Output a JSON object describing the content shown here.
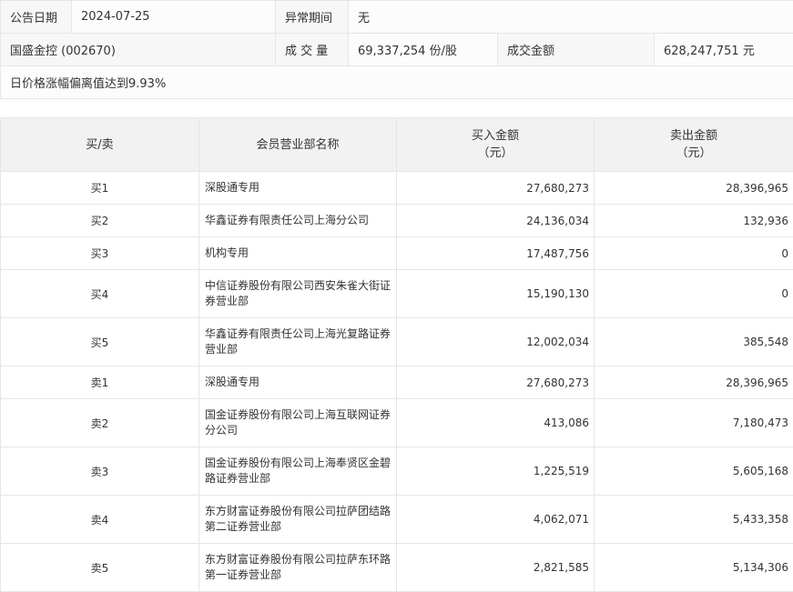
{
  "info": {
    "date_label": "公告日期",
    "date_value": "2024-07-25",
    "period_label": "异常期间",
    "period_value": "无",
    "stock": "国盛金控 (002670)",
    "volume_label": "成 交 量",
    "volume_value": "69,337,254 份/股",
    "amount_label": "成交金额",
    "amount_value": "628,247,751 元",
    "reason": "日价格涨幅偏离值达到9.93%"
  },
  "table": {
    "headers": {
      "side": "买/卖",
      "name": "会员营业部名称",
      "buy_l1": "买入金额",
      "buy_l2": "（元）",
      "sell_l1": "卖出金额",
      "sell_l2": "（元）"
    },
    "rows": [
      {
        "side": "买1",
        "name": "深股通专用",
        "buy": "27,680,273",
        "sell": "28,396,965"
      },
      {
        "side": "买2",
        "name": "华鑫证券有限责任公司上海分公司",
        "buy": "24,136,034",
        "sell": "132,936"
      },
      {
        "side": "买3",
        "name": "机构专用",
        "buy": "17,487,756",
        "sell": "0"
      },
      {
        "side": "买4",
        "name": "中信证券股份有限公司西安朱雀大街证券营业部",
        "buy": "15,190,130",
        "sell": "0"
      },
      {
        "side": "买5",
        "name": "华鑫证券有限责任公司上海光复路证券营业部",
        "buy": "12,002,034",
        "sell": "385,548"
      },
      {
        "side": "卖1",
        "name": "深股通专用",
        "buy": "27,680,273",
        "sell": "28,396,965"
      },
      {
        "side": "卖2",
        "name": "国金证券股份有限公司上海互联网证券分公司",
        "buy": "413,086",
        "sell": "7,180,473"
      },
      {
        "side": "卖3",
        "name": "国金证券股份有限公司上海奉贤区金碧路证券营业部",
        "buy": "1,225,519",
        "sell": "5,605,168"
      },
      {
        "side": "卖4",
        "name": "东方财富证券股份有限公司拉萨团结路第二证券营业部",
        "buy": "4,062,071",
        "sell": "5,433,358"
      },
      {
        "side": "卖5",
        "name": "东方财富证券股份有限公司拉萨东环路第一证券营业部",
        "buy": "2,821,585",
        "sell": "5,134,306"
      }
    ]
  }
}
